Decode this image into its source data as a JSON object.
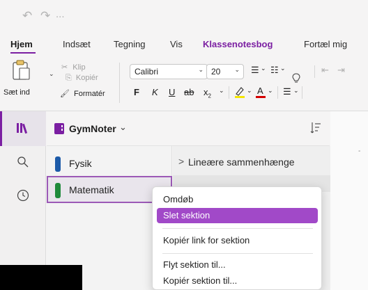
{
  "quickbar": {
    "undo_icon": "undo-icon",
    "redo_icon": "redo-icon",
    "more": "..."
  },
  "tabs": [
    {
      "label": "Hjem",
      "active": true
    },
    {
      "label": "Indsæt"
    },
    {
      "label": "Tegning"
    },
    {
      "label": "Vis"
    },
    {
      "label": "Klassenotesbog",
      "accent": true
    },
    {
      "label": "Fortæl mig"
    }
  ],
  "toolbar": {
    "paste_label": "Sæt ind",
    "cut_label": "Klip",
    "copy_label": "Kopiér",
    "format_label": "Formatér",
    "font_name": "Calibri",
    "font_size": "20",
    "bold": "F",
    "italic": "K",
    "underline": "U",
    "strike": "ab",
    "subscript": "x",
    "sub_mark": "2"
  },
  "notebook": {
    "name": "GymNoter"
  },
  "sections": [
    {
      "label": "Fysik",
      "color": "#1c5aa8"
    },
    {
      "label": "Matematik",
      "color": "#1f8a3b",
      "selected": true
    }
  ],
  "pages": [
    {
      "label": "Lineære sammenhænge"
    }
  ],
  "context_menu": {
    "rename": "Omdøb",
    "delete": "Slet sektion",
    "copy_link": "Kopiér link for sektion",
    "move": "Flyt sektion til...",
    "copy": "Kopiér sektion til..."
  },
  "colors": {
    "accent": "#7b1fa2",
    "highlight": "#a149c8"
  }
}
